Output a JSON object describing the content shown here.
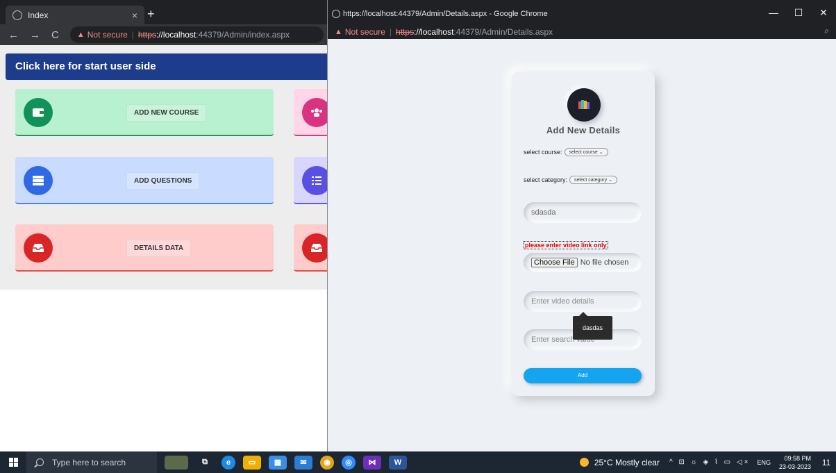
{
  "bg_browser": {
    "tab_title": "Index",
    "tab_close": "×",
    "new_tab": "+",
    "nav": {
      "back": "←",
      "forward": "→",
      "reload": "C"
    },
    "address": {
      "warning_icon": "▲",
      "not_secure": "Not secure",
      "separator": "|",
      "scheme": "https",
      "host": "://localhost",
      "path": ":44379/Admin/index.aspx"
    },
    "banner": "Click here for start user side",
    "cards": [
      {
        "label": "ADD NEW COURSE",
        "icon": "wallet-icon",
        "color": "#12915a"
      },
      {
        "label": "ADD QUESTIONS",
        "icon": "server-icon",
        "color": "#2f6ae4"
      },
      {
        "label": "DETAILS DATA",
        "icon": "inbox-icon",
        "color": "#d92525"
      }
    ],
    "peek_cards": [
      {
        "icon": "users-icon",
        "color": "#d83280"
      },
      {
        "icon": "checklist-icon",
        "color": "#5a4fe3"
      },
      {
        "icon": "inbox-icon",
        "color": "#d92525"
      }
    ]
  },
  "front_browser": {
    "window_title": "https://localhost:44379/Admin/Details.aspx - Google Chrome",
    "controls": {
      "minimize": "—",
      "maximize": "☐",
      "close": "✕"
    },
    "zoom_icon": "⌕",
    "address": {
      "warning_icon": "▲",
      "not_secure": "Not secure",
      "separator": "|",
      "scheme": "https",
      "host": "://localhost",
      "path": ":44379/Admin/Details.aspx"
    },
    "form": {
      "title": "Add New Details",
      "course_label": "select course:",
      "course_selected": "select course",
      "category_label": "select category:",
      "category_selected": "select category",
      "link_value": "sdasda",
      "error_text": "please enter video link only",
      "choose_file": "Choose File",
      "no_file": "No file chosen",
      "details_placeholder": "Enter video details",
      "search_placeholder": "Enter search value",
      "tooltip": "dasdas",
      "add_label": "Add"
    }
  },
  "taskbar": {
    "search_placeholder": "Type here to search",
    "weather": "25°C  Mostly clear",
    "tray_symbols": "^ ⊡ ☼ ◈ ⌇ ▭ ◁×",
    "lang": "ENG",
    "time": "09:58 PM",
    "date": "23-03-2023",
    "notification_badge": "11",
    "apps": [
      {
        "icon": "task-view-icon",
        "symbol": "⧉",
        "color": "transparent"
      },
      {
        "icon": "edge-icon",
        "symbol": "e",
        "color": "#1c8be6"
      },
      {
        "icon": "file-explorer-icon",
        "symbol": "▭",
        "color": "#f0b000"
      },
      {
        "icon": "store-icon",
        "symbol": "▦",
        "color": "#3a8ee6"
      },
      {
        "icon": "mail-icon",
        "symbol": "✉",
        "color": "#2b7cd3"
      },
      {
        "icon": "chrome-icon",
        "symbol": "◉",
        "color": "#e8a31c"
      },
      {
        "icon": "zoom-app-icon",
        "symbol": "◎",
        "color": "#2d8cff"
      },
      {
        "icon": "visual-studio-icon",
        "symbol": "⋈",
        "color": "#6b2fb8"
      },
      {
        "icon": "word-icon",
        "symbol": "W",
        "color": "#2b579a"
      }
    ]
  }
}
